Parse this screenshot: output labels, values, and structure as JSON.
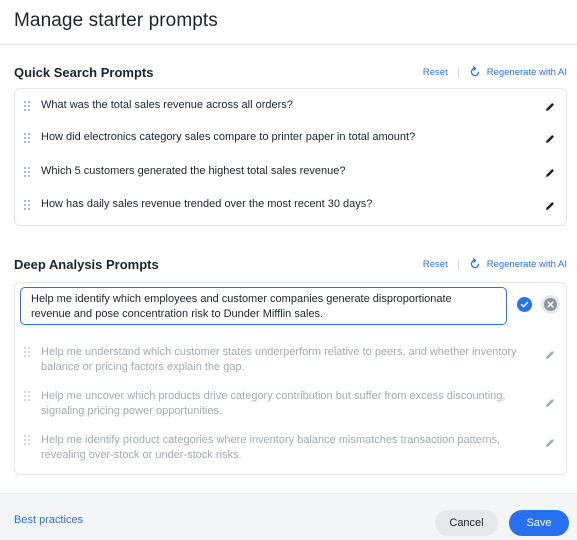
{
  "modal": {
    "title": "Manage starter prompts"
  },
  "quick": {
    "title": "Quick Search Prompts",
    "reset_label": "Reset",
    "regenerate_label": "Regenerate with AI",
    "items": [
      {
        "text": "What was the total sales revenue across all orders?"
      },
      {
        "text": "How did electronics category sales compare to printer paper in total amount?"
      },
      {
        "text": "Which 5 customers generated the highest total sales revenue?"
      },
      {
        "text": "How has daily sales revenue trended over the most recent 30 days?"
      }
    ]
  },
  "deep": {
    "title": "Deep Analysis Prompts",
    "reset_label": "Reset",
    "regenerate_label": "Regenerate with AI",
    "editing_value": "Help me identify which employees and customer companies generate disproportionate revenue and pose concentration risk to Dunder Mifflin sales.",
    "items": [
      {
        "text": "Help me understand which customer states underperform relative to peers, and whether inventory balance or pricing factors explain the gap."
      },
      {
        "text": "Help me uncover which products drive category contribution but suffer from excess discounting, signaling pricing power opportunities."
      },
      {
        "text": "Help me identify product categories where inventory balance mismatches transaction patterns, revealing over-stock or under-stock risks."
      }
    ]
  },
  "footer": {
    "best_practices_label": "Best practices",
    "cancel_label": "Cancel",
    "save_label": "Save"
  },
  "colors": {
    "accent": "#2770ef",
    "text": "#1d232f",
    "muted": "#a4a9b1"
  },
  "icons": [
    "drag-handle-icon",
    "pencil-icon",
    "regenerate-icon",
    "check-icon",
    "close-icon"
  ]
}
